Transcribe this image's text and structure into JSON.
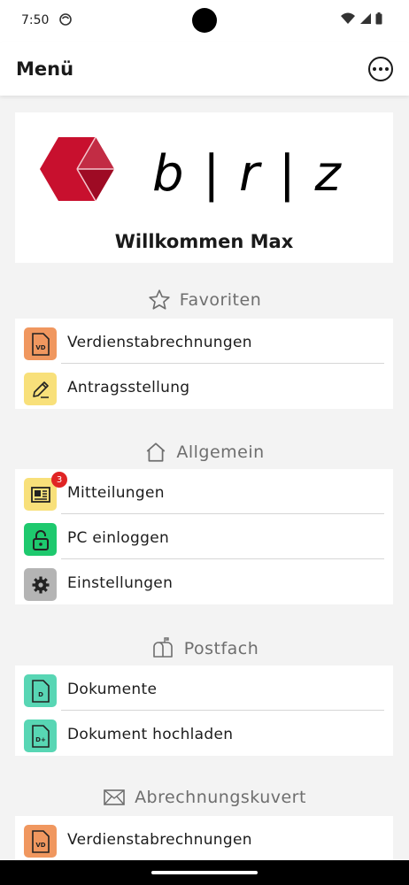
{
  "status_bar": {
    "time": "7:50"
  },
  "app_bar": {
    "title": "Menü"
  },
  "logo": {
    "text": "b | r | z"
  },
  "welcome": "Willkommen Max",
  "sections": {
    "favoriten": {
      "title": "Favoriten",
      "items": [
        {
          "label": "Verdienstabrechnungen",
          "icon_text": "VD"
        },
        {
          "label": "Antragsstellung"
        }
      ]
    },
    "allgemein": {
      "title": "Allgemein",
      "items": [
        {
          "label": "Mitteilungen",
          "badge": "3"
        },
        {
          "label": "PC einloggen"
        },
        {
          "label": "Einstellungen"
        }
      ]
    },
    "postfach": {
      "title": "Postfach",
      "items": [
        {
          "label": "Dokumente",
          "icon_text": "D"
        },
        {
          "label": "Dokument hochladen",
          "icon_text": "D+"
        }
      ]
    },
    "abrechnungskuvert": {
      "title": "Abrechnungskuvert",
      "items": [
        {
          "label": "Verdienstabrechnungen",
          "icon_text": "VD"
        }
      ]
    }
  },
  "colors": {
    "orange": "#f0975f",
    "yellow": "#f8e07a",
    "green": "#1ec96e",
    "gray": "#b4b4b4",
    "teal": "#58d6b4",
    "badge_red": "#e02424",
    "brand_red": "#c8102e"
  }
}
